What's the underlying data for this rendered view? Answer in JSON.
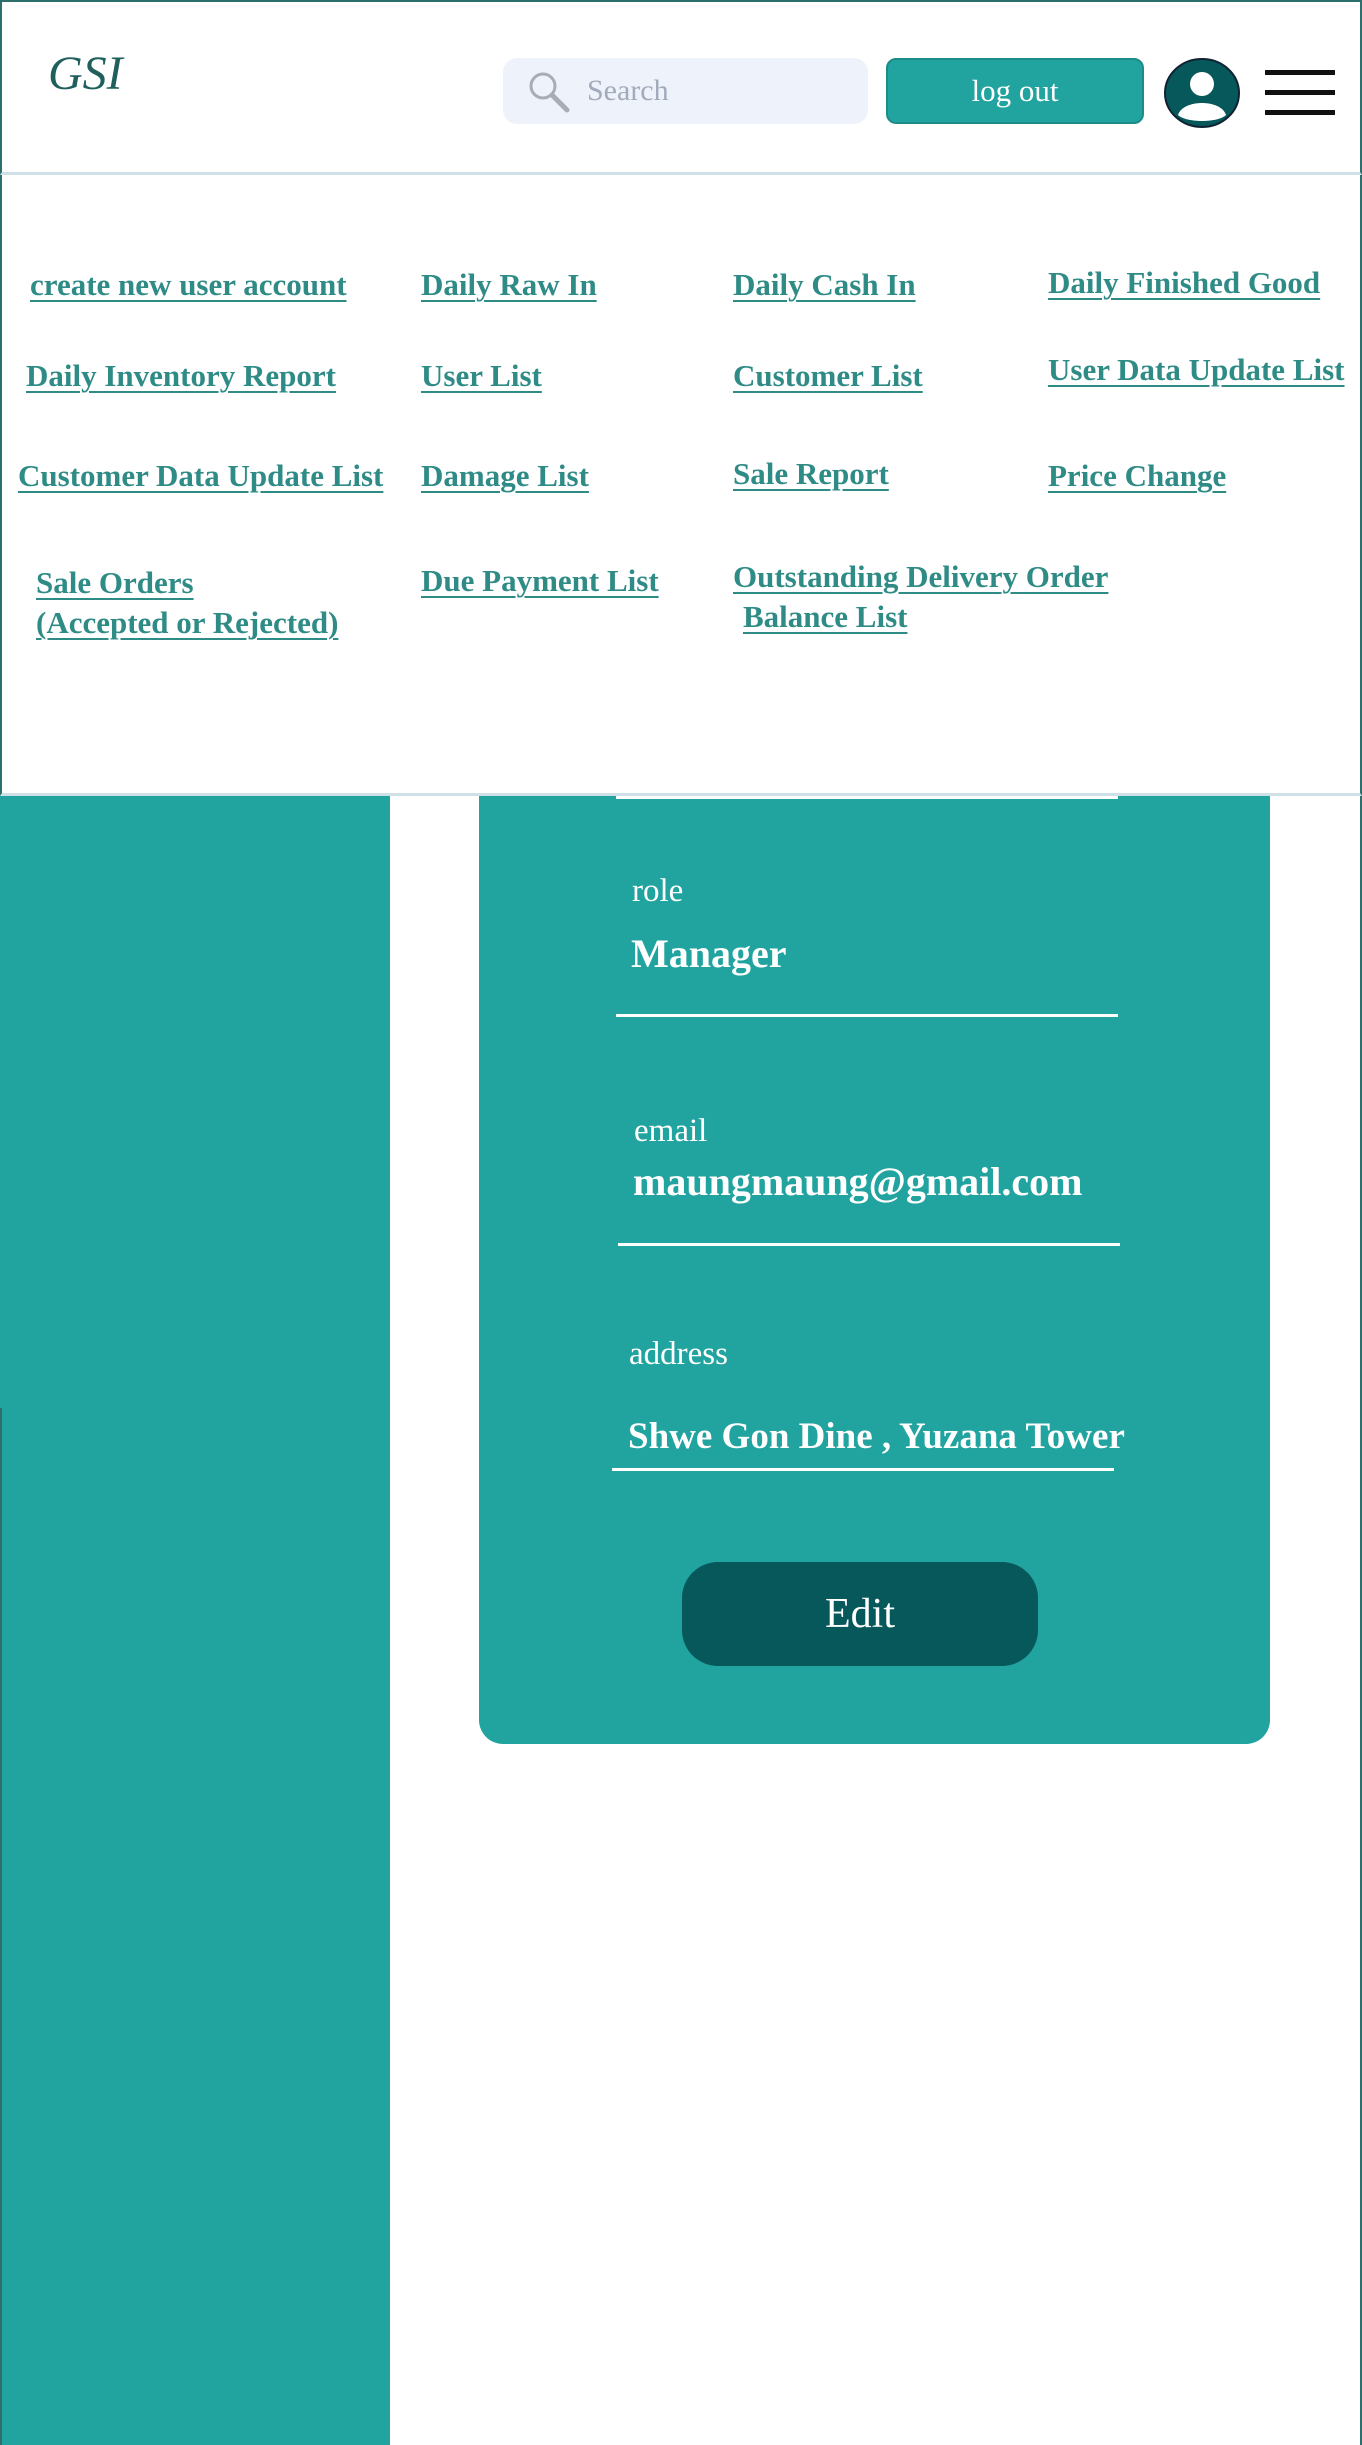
{
  "header": {
    "logo": "GSI",
    "search_placeholder": "Search",
    "logout_label": "log out"
  },
  "nav": {
    "create_user": "create new user account",
    "daily_raw_in": "Daily Raw In",
    "daily_cash_in": "Daily Cash In",
    "daily_finished_good": "Daily Finished Good",
    "daily_inventory_report": "Daily Inventory Report",
    "user_list": "User List",
    "customer_list": "Customer List",
    "user_data_update_list": "User Data Update List",
    "customer_data_update_list": "Customer Data Update List",
    "damage_list": "Damage List",
    "sale_report": "Sale Report",
    "price_change": "Price Change",
    "sale_orders_line1": "Sale Orders",
    "sale_orders_line2": "(Accepted or Rejected)",
    "due_payment_list": "Due Payment List",
    "outstanding_line1": "Outstanding Delivery Order",
    "outstanding_line2": "Balance List"
  },
  "profile": {
    "role_label": "role",
    "role_value": "Manager",
    "email_label": "email",
    "email_value": "maungmaung@gmail.com",
    "address_label": "address",
    "address_value": "Shwe Gon Dine , Yuzana Tower",
    "edit_label": "Edit"
  },
  "colors": {
    "accent": "#21a39f",
    "dark_accent": "#06585b",
    "link": "#2f8b86"
  }
}
